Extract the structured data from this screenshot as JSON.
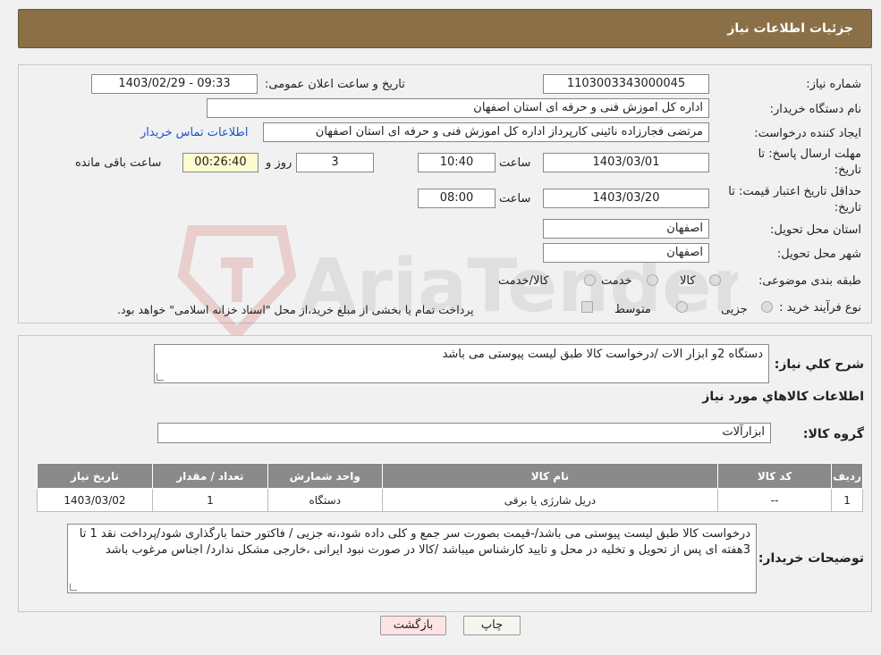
{
  "header": {
    "title": "جزئیات اطلاعات نیاز"
  },
  "fields": {
    "need_number_label": "شماره نیاز:",
    "need_number": "1103003343000045",
    "announce_label": "تاریخ و ساعت اعلان عمومی:",
    "announce_value": "1403/02/29 - 09:33",
    "buyer_org_label": "نام دستگاه خریدار:",
    "buyer_org": "اداره کل اموزش فنی و حرفه ای استان اصفهان",
    "creator_label": "ایجاد کننده درخواست:",
    "creator": "مرتضی فجارزاده نائینی کارپرداز اداره کل اموزش فنی و حرفه ای استان اصفهان",
    "contact_link": "اطلاعات تماس خریدار",
    "deadline_label_1": "مهلت ارسال پاسخ: تا",
    "deadline_label_2": "تاریخ:",
    "deadline_date": "1403/03/01",
    "time_label": "ساعت",
    "deadline_time": "10:40",
    "days": "3",
    "days_label": "روز و",
    "remaining": "00:26:40",
    "remaining_label": "ساعت باقی مانده",
    "validity_label_1": "حداقل تاریخ اعتبار قیمت: تا",
    "validity_label_2": "تاریخ:",
    "validity_date": "1403/03/20",
    "validity_time": "08:00",
    "province_label": "استان محل تحویل:",
    "province": "اصفهان",
    "city_label": "شهر محل تحویل:",
    "city": "اصفهان",
    "category_label": "طبقه بندی موضوعی:",
    "category_options": [
      "کالا",
      "خدمت",
      "کالا/خدمت"
    ],
    "process_label": "نوع فرآیند خرید :",
    "process_options": [
      "جزیی",
      "متوسط"
    ],
    "process_note": "پرداخت تمام یا بخشی از مبلغ خرید،از محل \"اسناد خزانه اسلامی\" خواهد بود."
  },
  "summary": {
    "label": "شرح كلي نياز:",
    "value": "دستگاه 2و ابزار الات /درخواست کالا طبق لیست پیوستی  می باشد"
  },
  "goods": {
    "heading": "اطلاعات كالاهاي مورد نياز",
    "group_label": "گروه کالا:",
    "group_value": "ابزارآلات",
    "columns": [
      "ردیف",
      "کد کالا",
      "نام کالا",
      "واحد شمارش",
      "تعداد / مقدار",
      "تاریخ نیاز"
    ],
    "rows": [
      {
        "index": "1",
        "code": "--",
        "name": "دریل شارژی یا برقی",
        "unit": "دستگاه",
        "qty": "1",
        "date": "1403/03/02"
      }
    ]
  },
  "buyer_notes": {
    "label": "توضیحات خریدار:",
    "value": "درخواست کالا طبق لیست پیوستی  می باشد/-قیمت بصورت سر جمع و کلی داده شود،نه جزیی / فاکتور حتما بارگذاری شود/پرداخت نقد 1 تا 3هفته ای پس از تحویل و تخلیه در محل و تایید کارشناس میباشد /کالا در صورت نبود ایرانی ،خارجی مشکل ندارد/ اجناس مرغوب باشد"
  },
  "buttons": {
    "print": "چاپ",
    "back": "بازگشت"
  },
  "watermark": {
    "text": "AriaTender.neT"
  }
}
